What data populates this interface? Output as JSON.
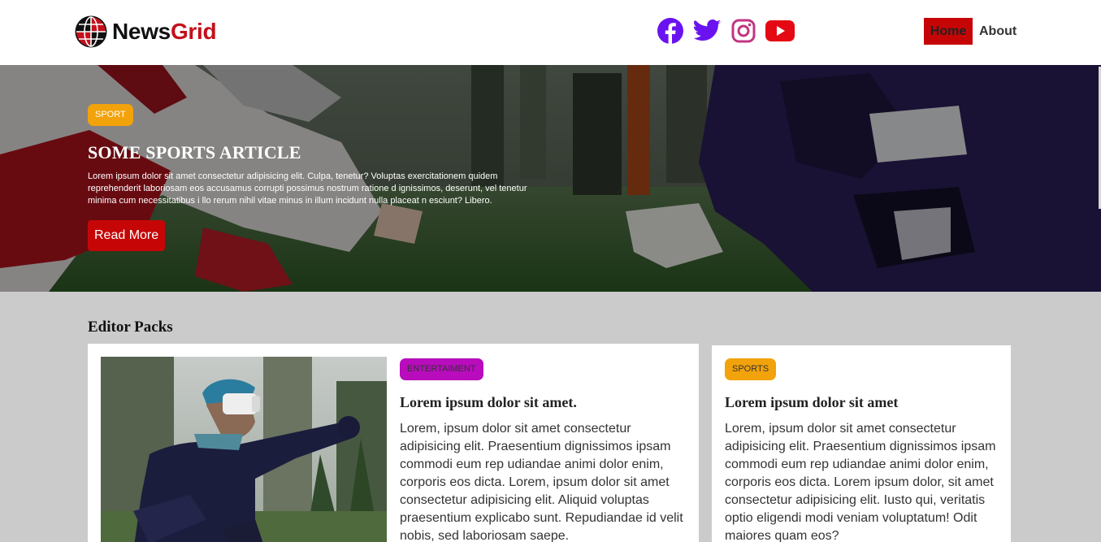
{
  "nav": {
    "logo_part1": "News",
    "logo_part2": "Grid",
    "social_icons": [
      "facebook-icon",
      "twitter-icon",
      "instagram-icon",
      "youtube-icon"
    ],
    "links": [
      {
        "label": "Home",
        "active": true
      },
      {
        "label": "About",
        "active": false
      }
    ]
  },
  "hero": {
    "tag": "SPORT",
    "title": "SOME SPORTS ARTICLE",
    "text": "Lorem ipsum dolor sit amet consectetur adipisicing elit. Culpa, tenetur? Voluptas exercitationem quidem reprehenderit laboriosam eos accusamus corrupti possimus nostrum ratione d ignissimos, deserunt, vel tenetur minima cum necessitatibus i llo rerum nihil vitae minus in illum incidunt nulla placeat n esciunt? Libero.",
    "button": "Read More"
  },
  "editor": {
    "title": "Editor Packs",
    "cards": [
      {
        "tag": "ENTERTAIMENT",
        "title": "Lorem ipsum dolor sit amet.",
        "text": "Lorem, ipsum dolor sit amet consectetur adipisicing elit. Praesentium dignissimos ipsam commodi eum rep udiandae animi dolor enim, corporis eos dicta. Lorem, ipsum dolor sit amet consectetur adipisicing elit. Aliquid voluptas praesentium explicabo sunt. Repudiandae id velit nobis, sed laboriosam saepe."
      },
      {
        "tag": "SPORTS",
        "title": "Lorem ipsum dolor sit amet",
        "text": "Lorem, ipsum dolor sit amet consectetur adipisicing elit. Praesentium dignissimos ipsam commodi eum rep udiandae animi dolor enim, corporis eos dicta. Lorem ipsum dolor, sit amet consectetur adipisicing elit. Iusto qui, veritatis optio eligendi modi veniam voluptatum! Odit maiores quam eos?"
      }
    ]
  },
  "colors": {
    "brand_red": "#c60606",
    "sport_tag": "#f2a20a",
    "entertainment_tag": "#b80cbd",
    "social_purple": "#6a13f0",
    "youtube_red": "#e50914"
  }
}
